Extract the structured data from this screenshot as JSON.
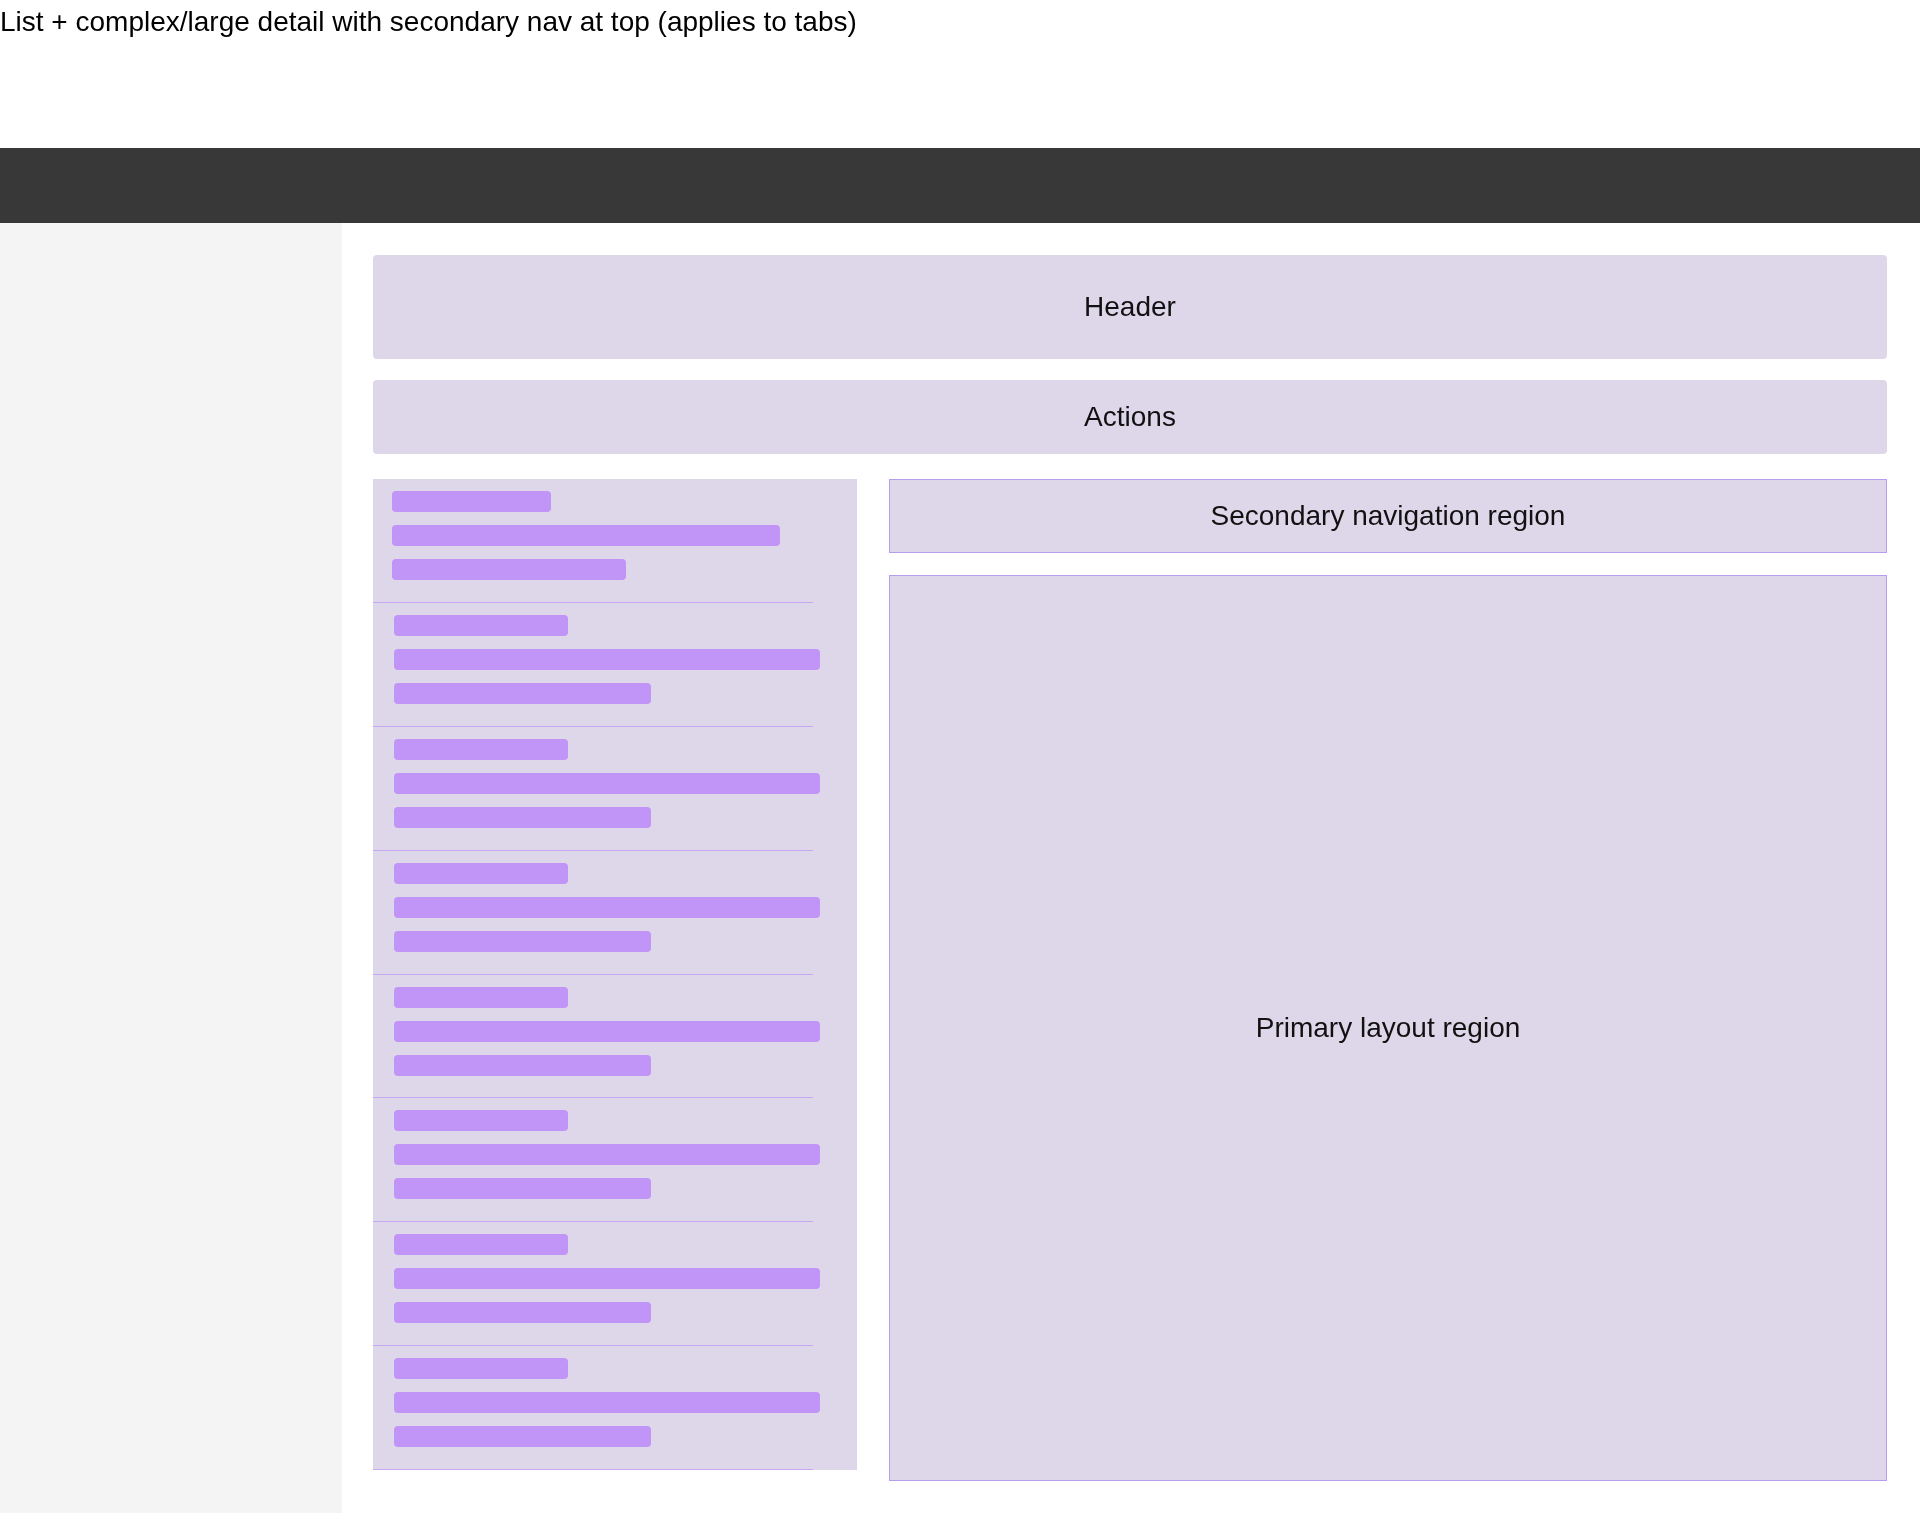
{
  "page_title": "List + complex/large detail with secondary nav at top (applies to tabs)",
  "header": {
    "label": "Header"
  },
  "actions": {
    "label": "Actions"
  },
  "secondary_nav": {
    "label": "Secondary navigation region"
  },
  "primary": {
    "label": "Primary layout region"
  }
}
